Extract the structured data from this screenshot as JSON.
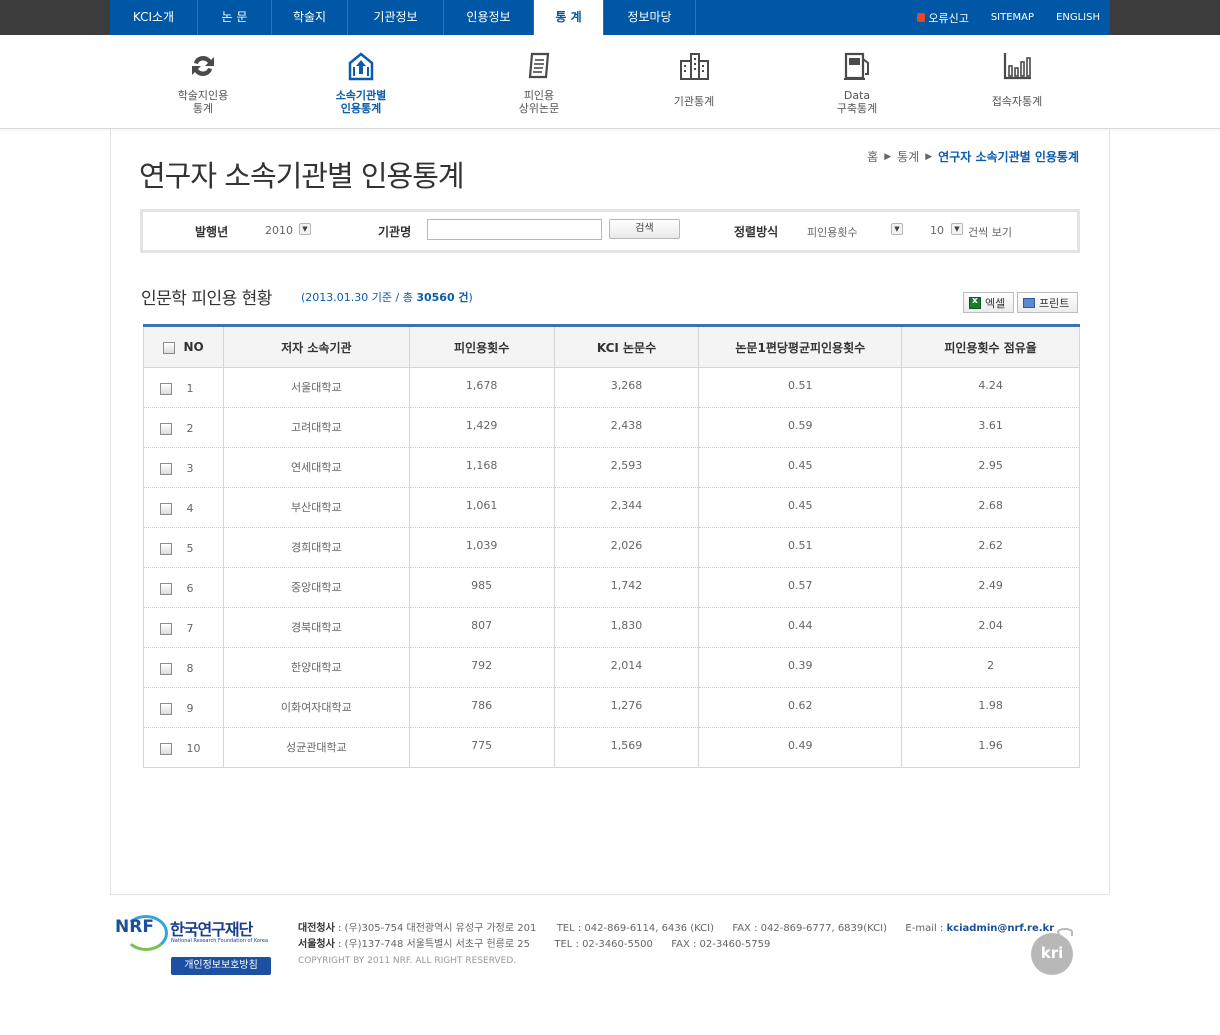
{
  "gnb": {
    "items": [
      {
        "label": "KCI소개"
      },
      {
        "label": "논 문"
      },
      {
        "label": "학술지"
      },
      {
        "label": "기관정보"
      },
      {
        "label": "인용정보"
      },
      {
        "label": "통 계"
      },
      {
        "label": "정보마당"
      }
    ],
    "active_index": 5
  },
  "util": {
    "report": "오류신고",
    "sitemap": "SITEMAP",
    "english": "ENGLISH"
  },
  "subnav": {
    "items": [
      {
        "line1": "학술지인용",
        "line2": "통계",
        "icon": "refresh-arrows-icon"
      },
      {
        "line1": "소속기관별",
        "line2": "인용통계",
        "icon": "institution-upload-icon"
      },
      {
        "line1": "피인용",
        "line2": "상위논문",
        "icon": "document-scroll-icon"
      },
      {
        "line1": "기관통계",
        "line2": "",
        "icon": "buildings-icon"
      },
      {
        "line1": "Data",
        "line2": "구축통계",
        "icon": "data-pump-icon"
      },
      {
        "line1": "접속자통계",
        "line2": "",
        "icon": "bar-chart-icon"
      }
    ],
    "active_index": 1
  },
  "page": {
    "title": "연구자 소속기관별 인용통계",
    "breadcrumb": [
      "홈",
      "통계",
      "연구자 소속기관별 인용통계"
    ]
  },
  "search": {
    "year_label": "발행년",
    "year_value": "2010",
    "org_label": "기관명",
    "org_value": "",
    "search_button": "검색",
    "sort_label": "정렬방식",
    "sort_value": "피인용횟수",
    "count_value": "10",
    "count_suffix": "건씩 보기"
  },
  "section": {
    "title": "인문학 피인용 현황",
    "info_prefix": "(2013.01.30 기준 / 총 ",
    "info_total": "30560 건",
    "info_suffix": ")",
    "excel_button": "엑셀",
    "print_button": "프린트"
  },
  "table": {
    "headers": [
      "NO",
      "저자 소속기관",
      "피인용횟수",
      "KCI 논문수",
      "논문1편당평균피인용횟수",
      "피인용횟수 점유율"
    ],
    "rows": [
      {
        "no": "1",
        "org": "서울대학교",
        "cited": "1,678",
        "papers": "3,268",
        "avg": "0.51",
        "share": "4.24"
      },
      {
        "no": "2",
        "org": "고려대학교",
        "cited": "1,429",
        "papers": "2,438",
        "avg": "0.59",
        "share": "3.61"
      },
      {
        "no": "3",
        "org": "연세대학교",
        "cited": "1,168",
        "papers": "2,593",
        "avg": "0.45",
        "share": "2.95"
      },
      {
        "no": "4",
        "org": "부산대학교",
        "cited": "1,061",
        "papers": "2,344",
        "avg": "0.45",
        "share": "2.68"
      },
      {
        "no": "5",
        "org": "경희대학교",
        "cited": "1,039",
        "papers": "2,026",
        "avg": "0.51",
        "share": "2.62"
      },
      {
        "no": "6",
        "org": "중앙대학교",
        "cited": "985",
        "papers": "1,742",
        "avg": "0.57",
        "share": "2.49"
      },
      {
        "no": "7",
        "org": "경북대학교",
        "cited": "807",
        "papers": "1,830",
        "avg": "0.44",
        "share": "2.04"
      },
      {
        "no": "8",
        "org": "한양대학교",
        "cited": "792",
        "papers": "2,014",
        "avg": "0.39",
        "share": "2"
      },
      {
        "no": "9",
        "org": "이화여자대학교",
        "cited": "786",
        "papers": "1,276",
        "avg": "0.62",
        "share": "1.98"
      },
      {
        "no": "10",
        "org": "성균관대학교",
        "cited": "775",
        "papers": "1,569",
        "avg": "0.49",
        "share": "1.96"
      }
    ]
  },
  "footer": {
    "logo_mark": "NRF",
    "logo_name": "한국연구재단",
    "logo_en": "National Research Foundation of Korea",
    "privacy": "개인정보보호방침",
    "daejeon_label": "대전청사",
    "daejeon_addr": " : (우)305-754 대전광역시 유성구 가정로 201",
    "daejeon_tel": "TEL : 042-869-6114, 6436 (KCI)",
    "daejeon_fax": "FAX : 042-869-6777, 6839(KCI)",
    "email_label": "E-mail : ",
    "email": "kciadmin@nrf.re.kr",
    "seoul_label": "서울청사",
    "seoul_addr": " : (우)137-748 서울특별시 서초구 헌릉로 25",
    "seoul_tel": "TEL : 02-3460-5500",
    "seoul_fax": "FAX : 02-3460-5759",
    "copyright": "COPYRIGHT BY 2011 NRF. ALL RIGHT RESERVED.",
    "kri_logo": "kri"
  }
}
